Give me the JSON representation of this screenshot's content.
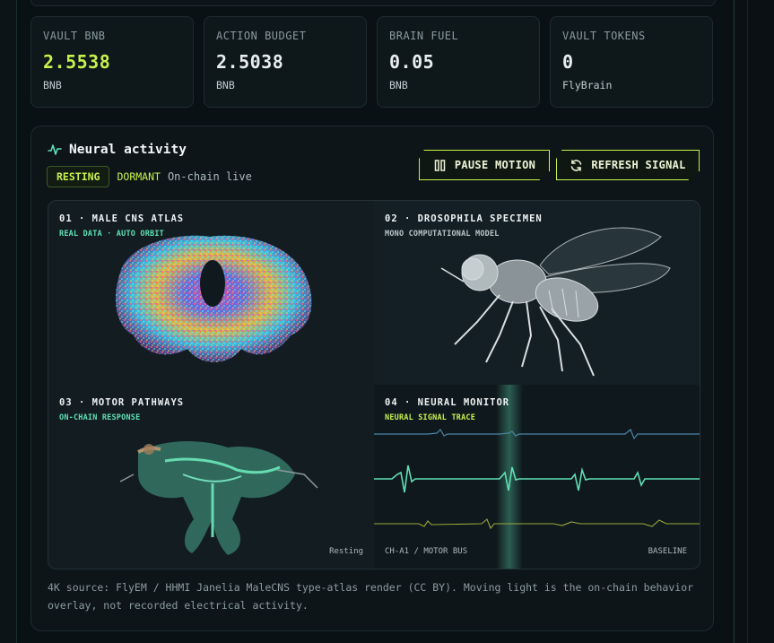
{
  "stats": [
    {
      "label": "VAULT BNB",
      "value": "2.5538",
      "unit": "BNB"
    },
    {
      "label": "ACTION BUDGET",
      "value": "2.5038",
      "unit": "BNB"
    },
    {
      "label": "BRAIN FUEL",
      "value": "0.05",
      "unit": "BNB"
    },
    {
      "label": "VAULT TOKENS",
      "value": "0",
      "unit": "FlyBrain"
    }
  ],
  "panel": {
    "title": "Neural activity",
    "state_badge": "RESTING",
    "state_secondary": "DORMANT",
    "live_text": "On-chain live",
    "pause_label": "PAUSE MOTION",
    "refresh_label": "REFRESH SIGNAL"
  },
  "viz": {
    "q1": {
      "title": "01 · MALE CNS ATLAS",
      "subtitle": "REAL DATA · AUTO ORBIT"
    },
    "q2": {
      "title": "02 · DROSOPHILA SPECIMEN",
      "subtitle": "MONO COMPUTATIONAL MODEL"
    },
    "q3": {
      "title": "03 · MOTOR PATHWAYS",
      "subtitle": "ON-CHAIN RESPONSE",
      "state": "Resting"
    },
    "q4": {
      "title": "04 · NEURAL MONITOR",
      "subtitle": "NEURAL SIGNAL TRACE",
      "left_label": "CH-A1 / MOTOR BUS",
      "right_label": "BASELINE"
    }
  },
  "footnote": "4K source: FlyEM / HHMI Janelia MaleCNS type-atlas render (CC BY). Moving light is the on-chain behavior overlay, not recorded electrical activity.",
  "colors": {
    "accent": "#c6f24e",
    "teal": "#5fe0b4",
    "trace_blue": "#4a86a8",
    "trace_olive": "#9aa83a"
  }
}
